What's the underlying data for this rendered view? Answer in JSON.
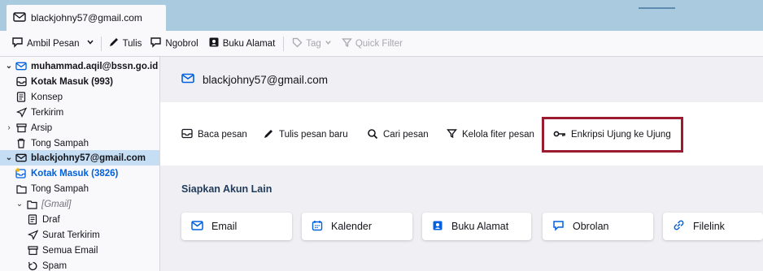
{
  "tab": {
    "title": "blackjohny57@gmail.com"
  },
  "toolbar": {
    "get_messages": "Ambil Pesan",
    "write": "Tulis",
    "chat": "Ngobrol",
    "address_book": "Buku Alamat",
    "tag": "Tag",
    "quick_filter": "Quick Filter"
  },
  "folders": [
    {
      "label": "muhammad.aqil@bssn.go.id",
      "icon": "mail-account-icon",
      "kind": "account"
    },
    {
      "label": "Kotak Masuk (993)",
      "icon": "inbox-icon",
      "kind": "folder-bold"
    },
    {
      "label": "Konsep",
      "icon": "draft-icon",
      "kind": "folder"
    },
    {
      "label": "Terkirim",
      "icon": "sent-icon",
      "kind": "folder"
    },
    {
      "label": "Arsip",
      "icon": "archive-icon",
      "kind": "folder"
    },
    {
      "label": "Tong Sampah",
      "icon": "trash-icon",
      "kind": "folder"
    },
    {
      "label": "blackjohny57@gmail.com",
      "icon": "mail-account-icon",
      "kind": "account-selected"
    },
    {
      "label": "Kotak Masuk (3826)",
      "icon": "inbox-icon",
      "kind": "folder-blue"
    },
    {
      "label": "Tong Sampah",
      "icon": "folder-icon",
      "kind": "folder"
    },
    {
      "label": "[Gmail]",
      "icon": "folder-icon",
      "kind": "folder-italic"
    },
    {
      "label": "Draf",
      "icon": "draft-icon",
      "kind": "folder"
    },
    {
      "label": "Surat Terkirim",
      "icon": "sent-icon",
      "kind": "folder"
    },
    {
      "label": "Semua Email",
      "icon": "archive-icon",
      "kind": "folder"
    },
    {
      "label": "Spam",
      "icon": "spam-icon",
      "kind": "folder"
    }
  ],
  "main": {
    "account_title": "blackjohny57@gmail.com",
    "actions": {
      "read": "Baca pesan",
      "write": "Tulis pesan baru",
      "search": "Cari pesan",
      "filters": "Kelola fiter pesan",
      "e2ee": "Enkripsi Ujung ke Ujung"
    },
    "setup_title": "Siapkan Akun Lain",
    "cards": {
      "email": "Email",
      "calendar": "Kalender",
      "address_book": "Buku Alamat",
      "chat": "Obrolan",
      "filelink": "Filelink"
    }
  },
  "colors": {
    "accent": "#0060df",
    "highlight": "#9b1c31",
    "tabbar": "#a9cadf",
    "selected": "#c5def3"
  }
}
